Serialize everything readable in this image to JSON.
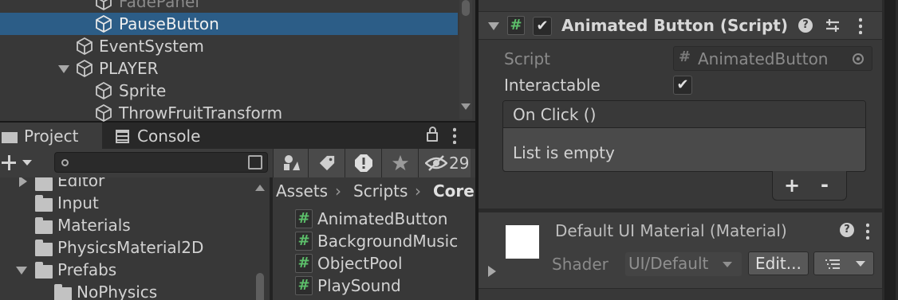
{
  "hierarchy": {
    "items": [
      {
        "label": "FadePanel"
      },
      {
        "label": "PauseButton"
      },
      {
        "label": "EventSystem"
      },
      {
        "label": "PLAYER"
      },
      {
        "label": "Sprite"
      },
      {
        "label": "ThrowFruitTransform"
      }
    ]
  },
  "tabs": {
    "project": "Project",
    "console": "Console"
  },
  "project": {
    "search_value": "",
    "hidden_count": "29",
    "breadcrumb": [
      "Assets",
      "Scripts",
      "Core"
    ],
    "folders": [
      {
        "label": "Editor"
      },
      {
        "label": "Input"
      },
      {
        "label": "Materials"
      },
      {
        "label": "PhysicsMaterial2D"
      },
      {
        "label": "Prefabs"
      },
      {
        "label": "NoPhysics"
      }
    ],
    "files": [
      {
        "label": "AnimatedButton"
      },
      {
        "label": "BackgroundMusic"
      },
      {
        "label": "ObjectPool"
      },
      {
        "label": "PlaySound"
      }
    ]
  },
  "inspector": {
    "component_title": "Animated Button (Script)",
    "script_label": "Script",
    "script_value": "AnimatedButton",
    "interactable_label": "Interactable",
    "interactable_checked": true,
    "event_title": "On Click ()",
    "event_empty": "List is empty",
    "add_label": "+",
    "remove_label": "-",
    "material_title": "Default UI Material (Material)",
    "shader_label": "Shader",
    "shader_value": "UI/Default",
    "edit_label": "Edit..."
  },
  "colors": {
    "selection": "#2c5d87",
    "panel": "#383838",
    "dark": "#282828",
    "hash_green": "#5cbf6a"
  }
}
